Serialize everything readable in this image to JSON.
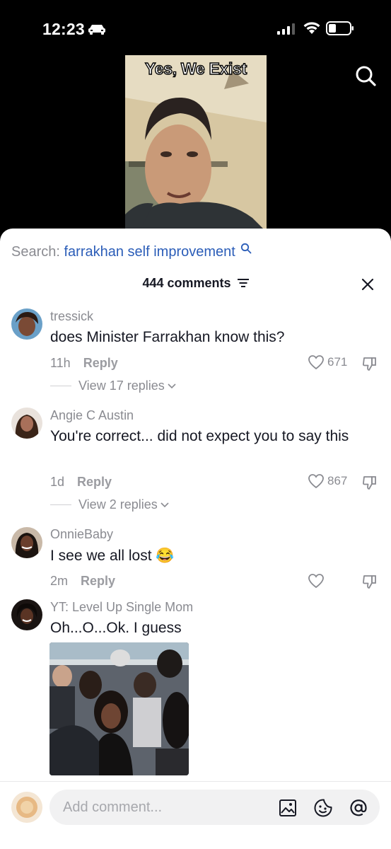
{
  "status_bar": {
    "time": "12:23",
    "icons": [
      "car-icon",
      "signal-icon",
      "wifi-icon",
      "battery-icon"
    ]
  },
  "video": {
    "caption": "Yes, We Exist",
    "search_icon": "search-icon"
  },
  "comments_panel": {
    "search_prefix": "Search:",
    "search_term": "farrakhan self improvement",
    "count_label": "444 comments",
    "filter_icon": "filter-icon",
    "close_icon": "close-icon"
  },
  "comments": [
    {
      "username": "tressick",
      "text": "does Minister Farrakhan know this?",
      "time": "11h",
      "reply_label": "Reply",
      "likes": "671",
      "view_replies": "View 17 replies"
    },
    {
      "username": "Angie C Austin",
      "text": "You're correct... did not expect you to say this",
      "time": "1d",
      "reply_label": "Reply",
      "likes": "867",
      "view_replies": "View 2 replies"
    },
    {
      "username": "OnnieBaby",
      "text": "I see we all lost 😂",
      "time": "2m",
      "reply_label": "Reply",
      "likes": ""
    },
    {
      "username": "YT: Level Up Single Mom",
      "text": "Oh...O...Ok. I guess"
    }
  ],
  "composer": {
    "placeholder": "Add comment...",
    "icons": [
      "image-icon",
      "emoji-icon",
      "mention-icon"
    ]
  },
  "colors": {
    "link_blue": "#2b5db8",
    "secondary_text": "#8a8b91",
    "primary_text": "#161823"
  }
}
